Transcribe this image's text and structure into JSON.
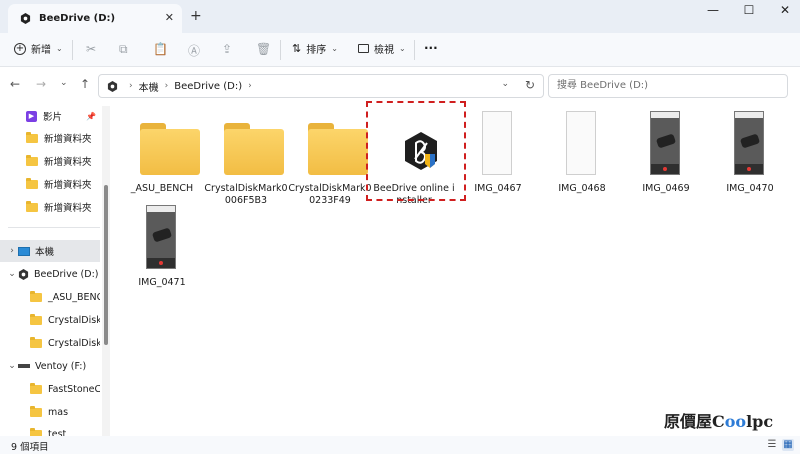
{
  "window": {
    "tab_title": "BeeDrive (D:)",
    "tab_close": "✕",
    "new_tab": "+",
    "minimize": "—",
    "maximize": "☐",
    "close": "✕"
  },
  "toolbar": {
    "new_label": "新增",
    "sort_label": "排序",
    "view_label": "檢視",
    "more": "···",
    "icons": [
      "cut-icon",
      "copy-icon",
      "paste-icon",
      "rename-icon",
      "share-icon",
      "delete-icon"
    ]
  },
  "address": {
    "crumbs": [
      "本機",
      "BeeDrive (D:)"
    ],
    "search_placeholder": "搜尋 BeeDrive (D:)"
  },
  "sidebar": {
    "quick": [
      {
        "label": "影片",
        "pinned": true
      },
      {
        "label": "新增資料夾"
      },
      {
        "label": "新增資料夾"
      },
      {
        "label": "新增資料夾"
      },
      {
        "label": "新增資料夾"
      }
    ],
    "this_pc": "本機",
    "drive": "BeeDrive (D:)",
    "drive_children": [
      "_ASU_BENCH",
      "CrystalDiskMa",
      "CrystalDiskMa"
    ],
    "ventoy": "Ventoy (F:)",
    "ventoy_children": [
      "FastStoneCap",
      "mas",
      "test"
    ]
  },
  "files": [
    {
      "name": "_ASU_BENCH",
      "type": "folder"
    },
    {
      "name": "CrystalDiskMark0006F5B3",
      "type": "folder"
    },
    {
      "name": "CrystalDiskMark00233F49",
      "type": "folder"
    },
    {
      "name": "BeeDrive online installer",
      "type": "app",
      "highlighted": true
    },
    {
      "name": "IMG_0467",
      "type": "image-light"
    },
    {
      "name": "IMG_0468",
      "type": "image-light"
    },
    {
      "name": "IMG_0469",
      "type": "image-dark"
    },
    {
      "name": "IMG_0470",
      "type": "image-dark"
    },
    {
      "name": "IMG_0471",
      "type": "image-dark"
    }
  ],
  "status": {
    "item_count": "9 個項目"
  },
  "watermark": {
    "prefix": "原價屋",
    "brand_c": "C",
    "brand_oo": "oo",
    "brand_rest": "lpc"
  },
  "colors": {
    "accent": "#1a5fb4",
    "folder": "#f5c542",
    "highlight": "#d01f1f"
  }
}
